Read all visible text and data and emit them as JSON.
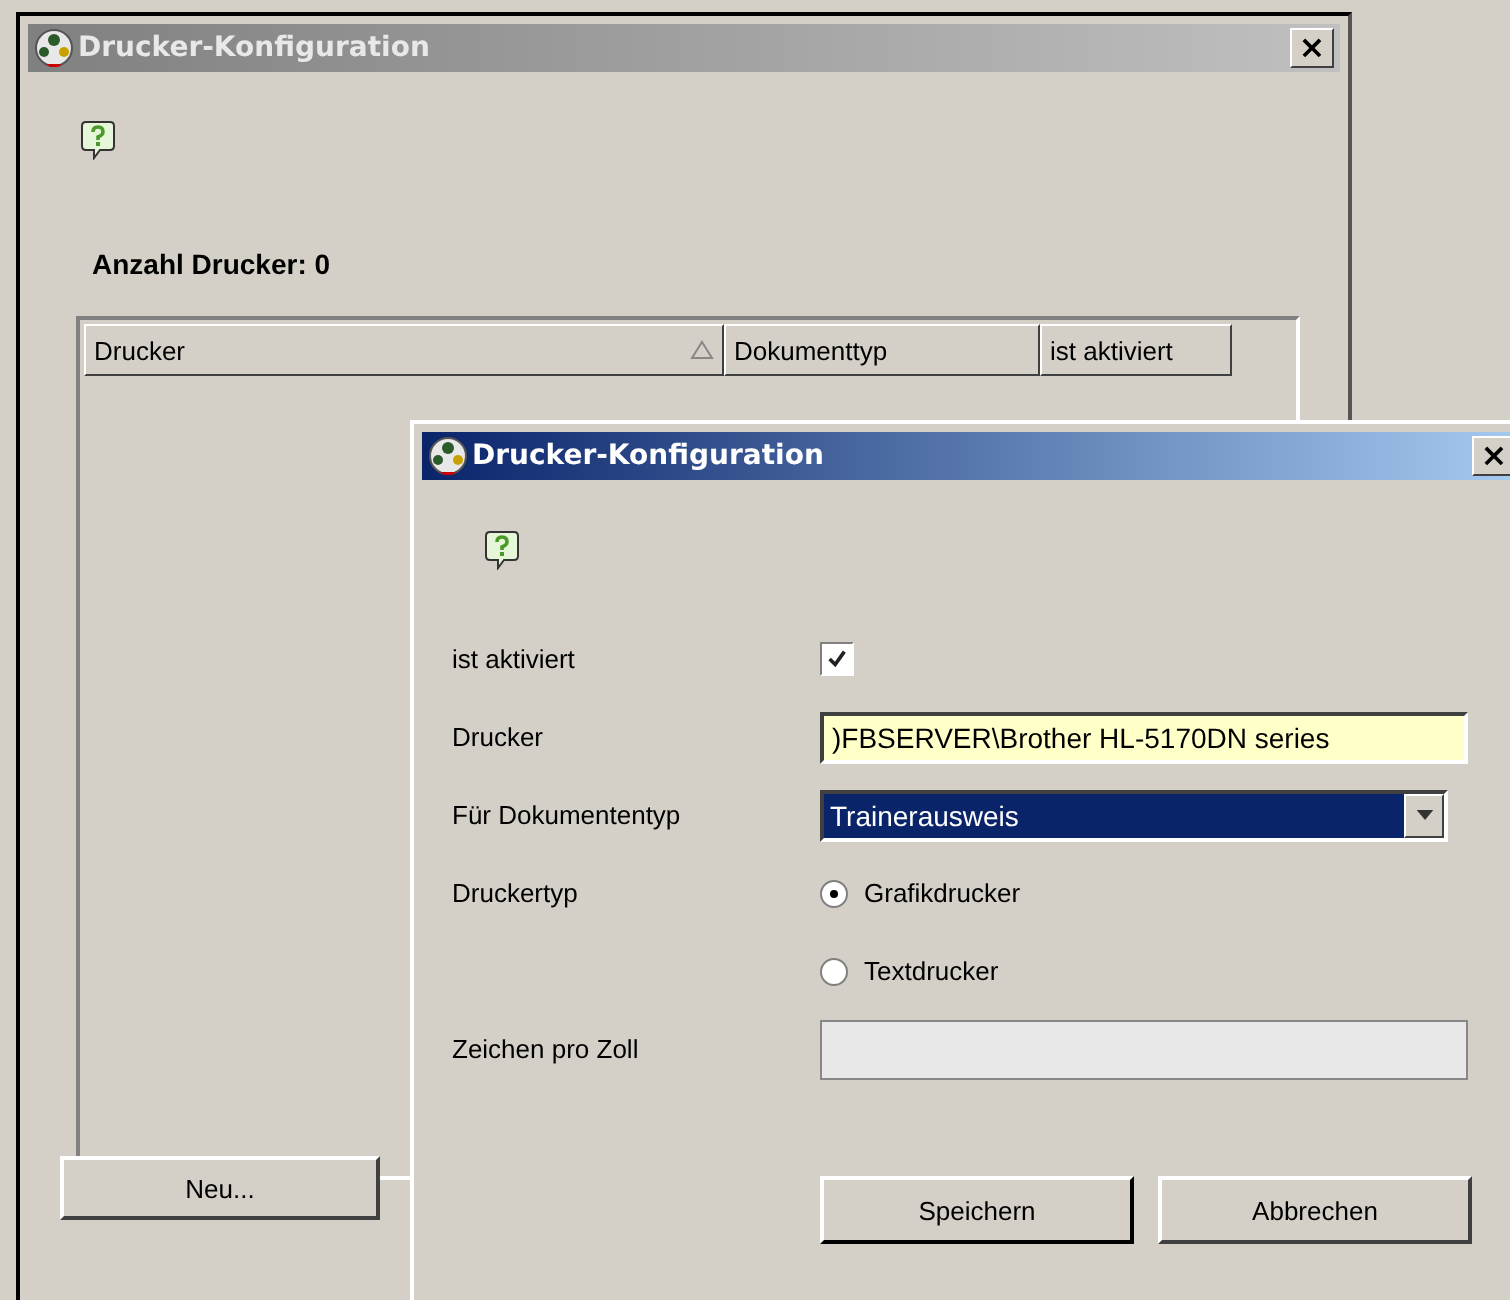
{
  "back_window": {
    "title": "Drucker-Konfiguration",
    "close": "×",
    "count_label": "Anzahl Drucker: 0",
    "table": {
      "columns": [
        {
          "label": "Drucker",
          "sorted": true
        },
        {
          "label": "Dokumenttyp",
          "sorted": false
        },
        {
          "label": "ist aktiviert",
          "sorted": false
        }
      ]
    },
    "buttons": [
      "Neu..."
    ]
  },
  "dialog": {
    "title": "Drucker-Konfiguration",
    "close": "×",
    "fields": [
      {
        "kind": "checkbox",
        "label": "ist aktiviert",
        "checked": true
      },
      {
        "kind": "text",
        "label": "Drucker",
        "value": ")FBSERVER\\Brother HL-5170DN series",
        "disabled": false
      },
      {
        "kind": "select",
        "label": "Für Dokumententyp",
        "value": "Trainerausweis"
      },
      {
        "kind": "radio",
        "label": "Druckertyp",
        "options": [
          {
            "label": "Grafikdrucker",
            "selected": true
          },
          {
            "label": "Textdrucker",
            "selected": false
          }
        ]
      },
      {
        "kind": "text",
        "label": "Zeichen pro Zoll",
        "disabled": true
      }
    ],
    "buttons": [
      "Speichern",
      "Abbrechen"
    ]
  }
}
